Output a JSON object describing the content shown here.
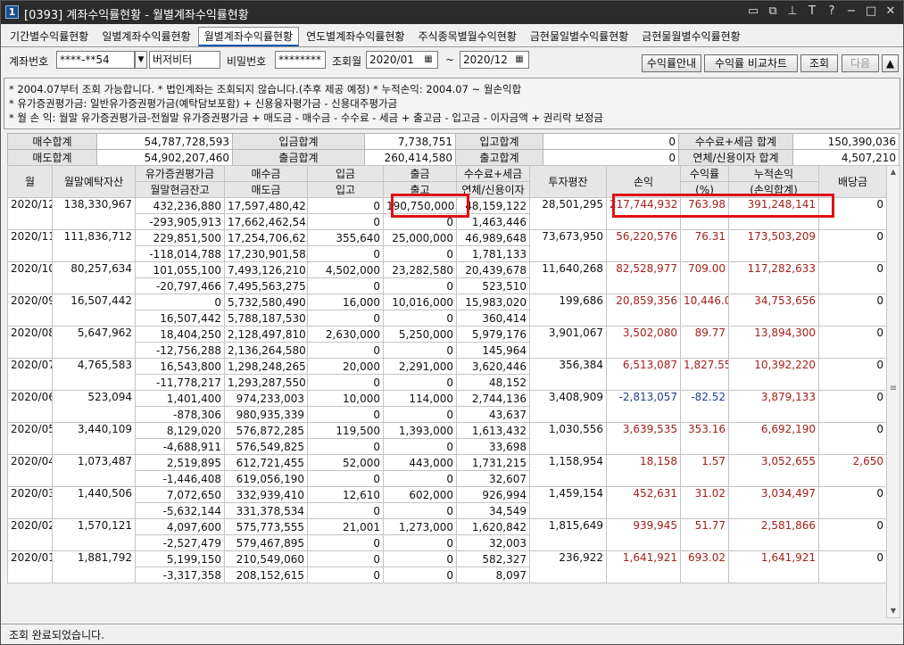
{
  "window": {
    "app_icon": "1",
    "title": "[0393] 계좌수익률현황 - 월별계좌수익률현황",
    "buttons": [
      "restore-icon",
      "tile-icon",
      "pin-icon",
      "font-icon",
      "help-icon",
      "minimize-icon",
      "maximize-icon",
      "close-icon"
    ]
  },
  "tabs": [
    {
      "label": "기간별수익률현황"
    },
    {
      "label": "일별계좌수익률현황"
    },
    {
      "label": "월별계좌수익률현황",
      "active": true
    },
    {
      "label": "연도별계좌수익률현황"
    },
    {
      "label": "주식종목별월수익현황"
    },
    {
      "label": "금현물일별수익률현황"
    },
    {
      "label": "금현물월별수익률현황"
    }
  ],
  "conditions": {
    "account_label": "계좌번호",
    "account_value": "****-**54",
    "account_name": "버저비터",
    "password_label": "비밀번호",
    "password_value": "********",
    "query_month_label": "조회월",
    "from_month": "2020/01",
    "separator": "~",
    "to_month": "2020/12"
  },
  "actions": {
    "guide": "수익률안내",
    "compare_chart": "수익률 비교차트",
    "search": "조회",
    "next": "다음"
  },
  "notes": [
    "* 2004.07부터 조회 가능합니다.   * 법인계좌는 조회되지 않습니다.(추후 제공 예정)   * 누적손익: 2004.07 ~ 월손익합",
    "* 유가증권평가금: 일반유가증권평가금(예탁담보포함) + 신용융자평가금 - 신용대주평가금",
    "* 월 손 익: 월말 유가증권평가금-전월말 유가증권평가금 + 매도금 - 매수금 - 수수료 - 세금 + 출고금 - 입고금 - 이자금액 + 권리락 보정금"
  ],
  "summary": {
    "r1": [
      {
        "label": "매수합계",
        "value": "54,787,728,593"
      },
      {
        "label": "입금합계",
        "value": "7,738,751"
      },
      {
        "label": "입고합계",
        "value": "0"
      },
      {
        "label": "수수료+세금 합계",
        "value": "150,390,036"
      }
    ],
    "r2": [
      {
        "label": "매도합계",
        "value": "54,902,207,460"
      },
      {
        "label": "출금합계",
        "value": "260,414,580"
      },
      {
        "label": "출고합계",
        "value": "0"
      },
      {
        "label": "연체/신용이자 합계",
        "value": "4,507,210"
      }
    ]
  },
  "grid": {
    "headers": {
      "month": "월",
      "deposit_asset": "월말예탁자산",
      "securities": "유가증권평가금",
      "cash_balance": "월말현금잔고",
      "buy": "매수금",
      "sell": "매도금",
      "deposit_in": "입금",
      "stock_in": "입고",
      "withdraw": "출금",
      "stock_out": "출고",
      "fee_tax": "수수료+세금",
      "interest": "연체/신용이자",
      "avg_invest": "투자평잔",
      "pnl": "손익",
      "ret": "수익률",
      "ret_unit": "(%)",
      "cum": "누적손익",
      "cum_sub": "(손익합계)",
      "dividend": "배당금"
    },
    "rows": [
      {
        "month": "2020/12",
        "asset": "138,330,967",
        "sec": "432,236,880",
        "cash": "-293,905,913",
        "buy": "17,597,480,425",
        "sell": "17,662,462,545",
        "din": "0",
        "sin": "0",
        "dout": "190,750,000",
        "sout": "0",
        "fee": "48,159,122",
        "int": "1,463,446",
        "avg": "28,501,295",
        "pnl": "217,744,932",
        "ret": "763.98",
        "cum": "391,248,141",
        "div": "0"
      },
      {
        "month": "2020/11",
        "asset": "111,836,712",
        "sec": "229,851,500",
        "cash": "-118,014,788",
        "buy": "17,254,706,625",
        "sell": "17,230,901,582",
        "din": "355,640",
        "sin": "0",
        "dout": "25,000,000",
        "sout": "0",
        "fee": "46,989,648",
        "int": "1,781,133",
        "avg": "73,673,950",
        "pnl": "56,220,576",
        "ret": "76.31",
        "cum": "173,503,209",
        "div": "0"
      },
      {
        "month": "2020/10",
        "asset": "80,257,634",
        "sec": "101,055,100",
        "cash": "-20,797,466",
        "buy": "7,493,126,210",
        "sell": "7,495,563,275",
        "din": "4,502,000",
        "sin": "0",
        "dout": "23,282,580",
        "sout": "0",
        "fee": "20,439,678",
        "int": "523,510",
        "avg": "11,640,268",
        "pnl": "82,528,977",
        "ret": "709.00",
        "cum": "117,282,633",
        "div": "0"
      },
      {
        "month": "2020/09",
        "asset": "16,507,442",
        "sec": "0",
        "cash": "16,507,442",
        "buy": "5,732,580,490",
        "sell": "5,788,187,530",
        "din": "16,000",
        "sin": "0",
        "dout": "10,016,000",
        "sout": "0",
        "fee": "15,983,020",
        "int": "360,414",
        "avg": "199,686",
        "pnl": "20,859,356",
        "ret": "10,446.08",
        "cum": "34,753,656",
        "div": "0"
      },
      {
        "month": "2020/08",
        "asset": "5,647,962",
        "sec": "18,404,250",
        "cash": "-12,756,288",
        "buy": "2,128,497,810",
        "sell": "2,136,264,580",
        "din": "2,630,000",
        "sin": "0",
        "dout": "5,250,000",
        "sout": "0",
        "fee": "5,979,176",
        "int": "145,964",
        "avg": "3,901,067",
        "pnl": "3,502,080",
        "ret": "89.77",
        "cum": "13,894,300",
        "div": "0"
      },
      {
        "month": "2020/07",
        "asset": "4,765,583",
        "sec": "16,543,800",
        "cash": "-11,778,217",
        "buy": "1,298,248,265",
        "sell": "1,293,287,550",
        "din": "20,000",
        "sin": "0",
        "dout": "2,291,000",
        "sout": "0",
        "fee": "3,620,446",
        "int": "48,152",
        "avg": "356,384",
        "pnl": "6,513,087",
        "ret": "1,827.55",
        "cum": "10,392,220",
        "div": "0"
      },
      {
        "month": "2020/06",
        "asset": "523,094",
        "sec": "1,401,400",
        "cash": "-878,306",
        "buy": "974,233,003",
        "sell": "980,935,339",
        "din": "10,000",
        "sin": "0",
        "dout": "114,000",
        "sout": "0",
        "fee": "2,744,136",
        "int": "43,637",
        "avg": "3,408,909",
        "pnl": "-2,813,057",
        "ret": "-82.52",
        "cum": "3,879,133",
        "div": "0"
      },
      {
        "month": "2020/05",
        "asset": "3,440,109",
        "sec": "8,129,020",
        "cash": "-4,688,911",
        "buy": "576,872,285",
        "sell": "576,549,825",
        "din": "119,500",
        "sin": "0",
        "dout": "1,393,000",
        "sout": "0",
        "fee": "1,613,432",
        "int": "33,698",
        "avg": "1,030,556",
        "pnl": "3,639,535",
        "ret": "353.16",
        "cum": "6,692,190",
        "div": "0"
      },
      {
        "month": "2020/04",
        "asset": "1,073,487",
        "sec": "2,519,895",
        "cash": "-1,446,408",
        "buy": "612,721,455",
        "sell": "619,056,190",
        "din": "52,000",
        "sin": "0",
        "dout": "443,000",
        "sout": "0",
        "fee": "1,731,215",
        "int": "32,607",
        "avg": "1,158,954",
        "pnl": "18,158",
        "ret": "1.57",
        "cum": "3,052,655",
        "div": "2,650"
      },
      {
        "month": "2020/03",
        "asset": "1,440,506",
        "sec": "7,072,650",
        "cash": "-5,632,144",
        "buy": "332,939,410",
        "sell": "331,378,534",
        "din": "12,610",
        "sin": "0",
        "dout": "602,000",
        "sout": "0",
        "fee": "926,994",
        "int": "34,549",
        "avg": "1,459,154",
        "pnl": "452,631",
        "ret": "31.02",
        "cum": "3,034,497",
        "div": "0"
      },
      {
        "month": "2020/02",
        "asset": "1,570,121",
        "sec": "4,097,600",
        "cash": "-2,527,479",
        "buy": "575,773,555",
        "sell": "579,467,895",
        "din": "21,001",
        "sin": "0",
        "dout": "1,273,000",
        "sout": "0",
        "fee": "1,620,842",
        "int": "32,003",
        "avg": "1,815,649",
        "pnl": "939,945",
        "ret": "51.77",
        "cum": "2,581,866",
        "div": "0"
      },
      {
        "month": "2020/01",
        "asset": "1,881,792",
        "sec": "5,199,150",
        "cash": "-3,317,358",
        "buy": "210,549,060",
        "sell": "208,152,615",
        "din": "0",
        "sin": "0",
        "dout": "0",
        "sout": "0",
        "fee": "582,327",
        "int": "8,097",
        "avg": "236,922",
        "pnl": "1,641,921",
        "ret": "693.02",
        "cum": "1,641,921",
        "div": "0"
      }
    ]
  },
  "status": {
    "message": "조회 완료되었습니다."
  },
  "colors": {
    "positive": "#a3201c",
    "negative": "#1f3f8f",
    "highlight_box": "#e01015",
    "active_tab_border": "#1a55a8"
  }
}
